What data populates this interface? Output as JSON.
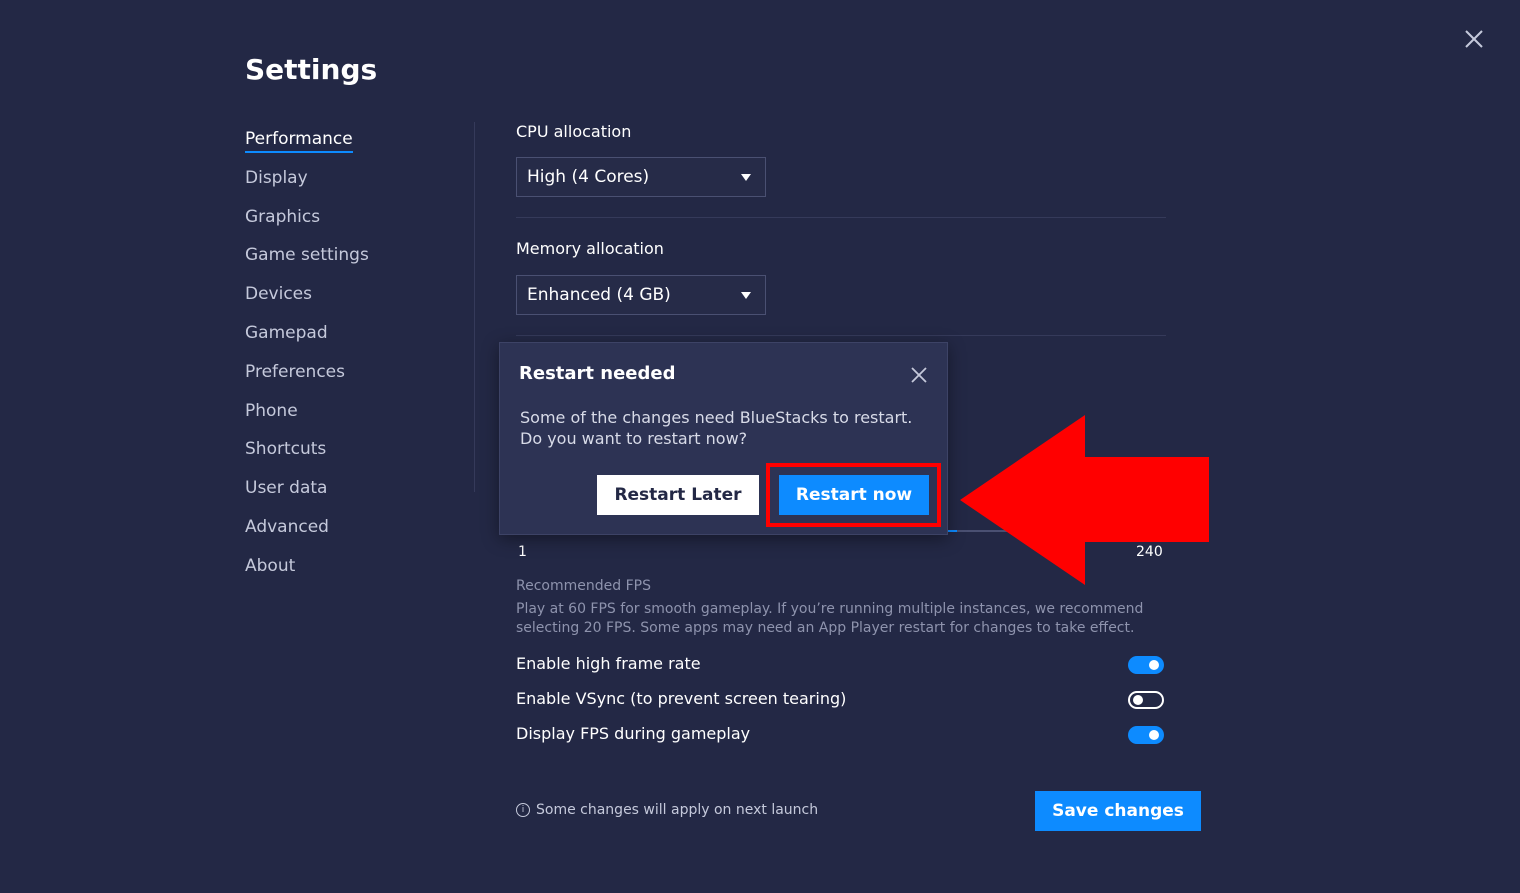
{
  "window": {
    "title": "Settings"
  },
  "sidebar": {
    "items": [
      {
        "label": "Performance",
        "active": true
      },
      {
        "label": "Display"
      },
      {
        "label": "Graphics"
      },
      {
        "label": "Game settings"
      },
      {
        "label": "Devices"
      },
      {
        "label": "Gamepad"
      },
      {
        "label": "Preferences"
      },
      {
        "label": "Phone"
      },
      {
        "label": "Shortcuts"
      },
      {
        "label": "User data"
      },
      {
        "label": "Advanced"
      },
      {
        "label": "About"
      }
    ]
  },
  "performance": {
    "cpu": {
      "label": "CPU allocation",
      "value": "High (4 Cores)"
    },
    "memory": {
      "label": "Memory allocation",
      "value": "Enhanced (4 GB)"
    },
    "fps_slider": {
      "min": "1",
      "max": "240",
      "fill_fraction": 0.68
    },
    "recommended": {
      "title": "Recommended FPS",
      "description": "Play at 60 FPS for smooth gameplay. If you’re running multiple instances, we recommend selecting 20 FPS. Some apps may need an App Player restart for changes to take effect."
    },
    "toggles": [
      {
        "label": "Enable high frame rate",
        "on": true
      },
      {
        "label": "Enable VSync (to prevent screen tearing)",
        "on": false
      },
      {
        "label": "Display FPS during gameplay",
        "on": true
      }
    ]
  },
  "footer": {
    "note": "Some changes will apply on next launch",
    "info_glyph": "i",
    "save_label": "Save changes"
  },
  "dialog": {
    "title": "Restart needed",
    "message": "Some of the changes need BlueStacks to restart. Do you want to restart now?",
    "later_label": "Restart Later",
    "now_label": "Restart now"
  },
  "colors": {
    "background": "#232845",
    "accent": "#0d8bff",
    "dialog_bg": "#2d3354",
    "annotation": "#ff0000"
  },
  "icons": {
    "close": "close-icon",
    "dropdown": "chevron-down-icon",
    "info": "info-icon",
    "annotation": "red-arrow-icon"
  }
}
